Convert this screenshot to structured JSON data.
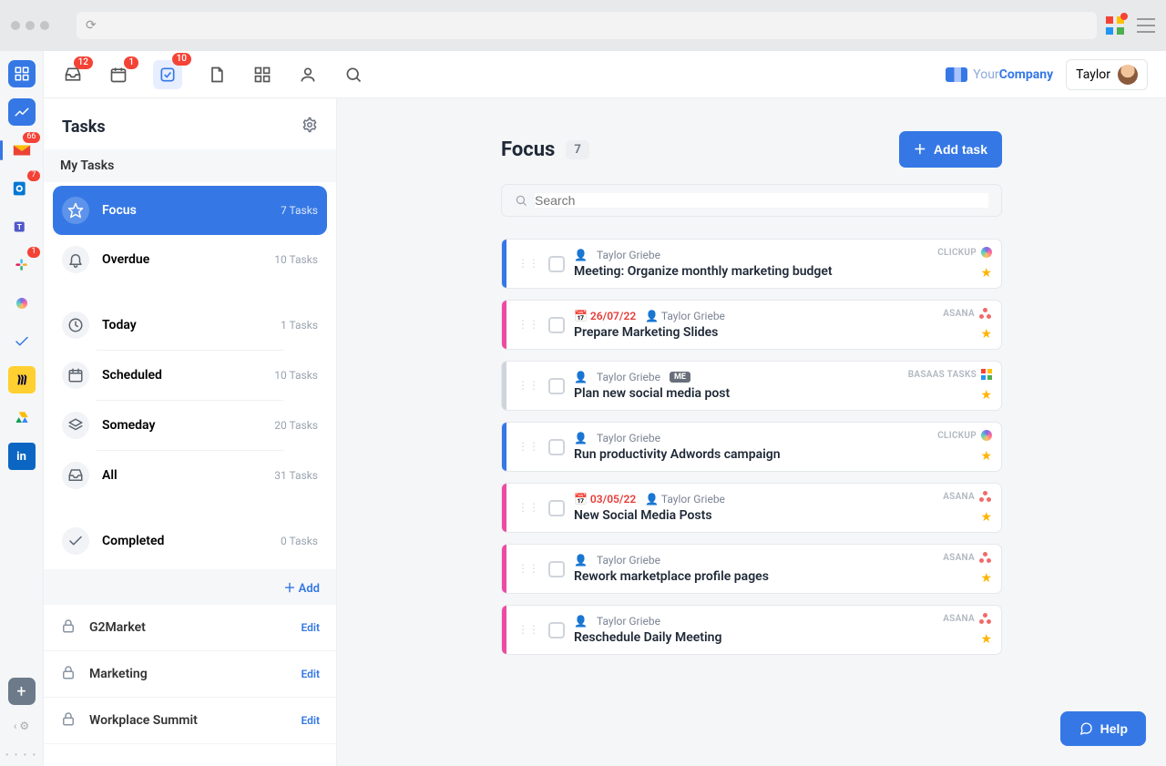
{
  "topbar": {
    "badges": {
      "inbox": "12",
      "calendar": "1",
      "tasks": "10"
    },
    "company_prefix": "Your",
    "company_suffix": "Company",
    "user_name": "Taylor"
  },
  "rail": {
    "badges": {
      "gmail": "66",
      "outlook": "7",
      "slack": "1"
    }
  },
  "panel": {
    "title": "Tasks",
    "subheader": "My Tasks",
    "categories": [
      {
        "icon": "star",
        "label": "Focus",
        "count": "7 Tasks",
        "active": true
      },
      {
        "icon": "bell",
        "label": "Overdue",
        "count": "10 Tasks"
      },
      {
        "gap": true
      },
      {
        "icon": "clock",
        "label": "Today",
        "count": "1 Tasks"
      },
      {
        "icon": "calendar",
        "label": "Scheduled",
        "count": "10 Tasks"
      },
      {
        "icon": "stack",
        "label": "Someday",
        "count": "20 Tasks"
      },
      {
        "icon": "inbox",
        "label": "All",
        "count": "31 Tasks"
      },
      {
        "gap": true
      },
      {
        "icon": "check",
        "label": "Completed",
        "count": "0 Tasks"
      }
    ],
    "add_label": "Add",
    "projects": [
      {
        "label": "G2Market",
        "action": "Edit"
      },
      {
        "label": "Marketing",
        "action": "Edit"
      },
      {
        "label": "Workplace Summit",
        "action": "Edit"
      }
    ]
  },
  "main": {
    "title": "Focus",
    "count": "7",
    "add_task_label": "Add task",
    "search_placeholder": "Search",
    "tasks": [
      {
        "stripe": "blue",
        "assignee": "Taylor Griebe",
        "title": "Meeting: Organize monthly marketing budget",
        "source": "CLICKUP",
        "starred": true
      },
      {
        "stripe": "pink",
        "date": "26/07/22",
        "assignee": "Taylor Griebe",
        "title": "Prepare Marketing Slides",
        "source": "ASANA",
        "starred": true
      },
      {
        "stripe": "gray",
        "assignee": "Taylor Griebe",
        "me": "ME",
        "title": "Plan new social media post",
        "source": "BASAAS TASKS",
        "starred": true
      },
      {
        "stripe": "blue",
        "assignee": "Taylor Griebe",
        "title": "Run productivity Adwords campaign",
        "source": "CLICKUP",
        "starred": true
      },
      {
        "stripe": "pink",
        "date": "03/05/22",
        "assignee": "Taylor Griebe",
        "title": "New Social Media Posts",
        "source": "ASANA",
        "starred": true
      },
      {
        "stripe": "pink",
        "assignee": "Taylor Griebe",
        "title": "Rework marketplace profile pages",
        "source": "ASANA",
        "starred": true
      },
      {
        "stripe": "pink",
        "assignee": "Taylor Griebe",
        "title": "Reschedule Daily Meeting",
        "source": "ASANA",
        "starred": true
      }
    ]
  },
  "help_label": "Help"
}
